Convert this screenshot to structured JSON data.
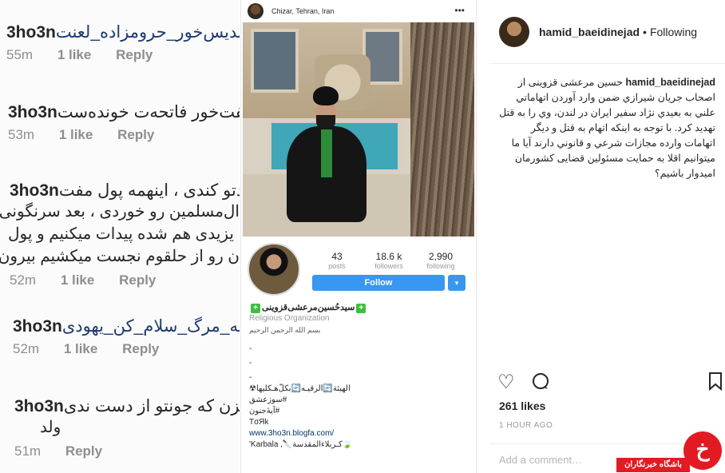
{
  "comments": [
    {
      "user": "3ho3n",
      "hashtag": "#ندیس‌خور_حرومزاده_لعنت",
      "time": "55m",
      "likes": "1 like",
      "reply": "Reply"
    },
    {
      "user": "3ho3n",
      "text": "مفت‌خور فاتحه‌ت خونده‌ست",
      "time": "53m",
      "likes": "1 like",
      "reply": "Reply"
    },
    {
      "user": "3ho3n",
      "text": "دتو کندی ، اینهمه پول مفت",
      "extra": [
        "ال‌مسلمین رو خوردی ، بعد سرنگونی",
        "یزیدی هم شده پیدات میکنیم و پول",
        "ن رو از حلقوم نجست میکشیم بیرون"
      ],
      "time": "52m",
      "likes": "1 like",
      "reply": "Reply"
    },
    {
      "user": "3ho3n",
      "hashtag": "#به_مرگ_سلام_کن_یهودی",
      "time": "52m",
      "likes": "1 like",
      "reply": "Reply"
    },
    {
      "user": "3ho3n",
      "text": "نزن که جونتو از دست ندی",
      "extra": [
        "ولد"
      ],
      "time": "51m",
      "reply": "Reply"
    }
  ],
  "profile_shot": {
    "location": "Chizar, Tehran, Iran",
    "more_icon": "more-horizontal-icon",
    "stats": [
      {
        "num": "43",
        "label": "posts"
      },
      {
        "num": "18.6 k",
        "label": "followers"
      },
      {
        "num": "2,990",
        "label": "following"
      }
    ],
    "follow_label": "Follow",
    "follow_dropdown": "▾",
    "name": "سیدحُسین‌مرعشی‌قزوینی",
    "category": "Religious Organization",
    "bio_lines": [
      "بسم الله الرحمن الرحیم",
      "-",
      "-",
      "-",
      "الهیئة🔄الرقیـه🔄بکلّ‌هـکلیها☢",
      "#سوزعشق",
      "#آیهٔ‌جنون",
      "TσЯk",
      "www.3ho3n.blogfa.com/",
      "'Karbala ,🔪کـربلاء‌المقدسة🍃"
    ]
  },
  "post": {
    "username": "hamid_baeidinejad",
    "dot": "•",
    "follow_status": "Following",
    "caption_user": "hamid_baeidinejad",
    "caption": "حسین مرعشی قزوینی از اصحاب جریان شیرازي ضمن وارد آوردن اتهاماتي علني به بعیدي نژاد سفیر ایران در لندن، وي را به قتل تهدید کرد. با توجه به اینکه اتهام به قتل و دیگر اتهامات وارده مجازات شرعي و قانوني دارند آیا ما میتوانیم اقلا به حمایت مسئولین قضایی کشورمان امیدوار باشیم؟",
    "likes": "261 likes",
    "time": "1 HOUR AGO",
    "comment_placeholder": "Add a comment…",
    "icons": {
      "like": "heart-icon",
      "comment": "comment-icon",
      "save": "bookmark-icon"
    }
  },
  "watermark": {
    "circle": "خ",
    "label": "باشگاه خبرنگاران",
    "color": "#e21b22"
  }
}
